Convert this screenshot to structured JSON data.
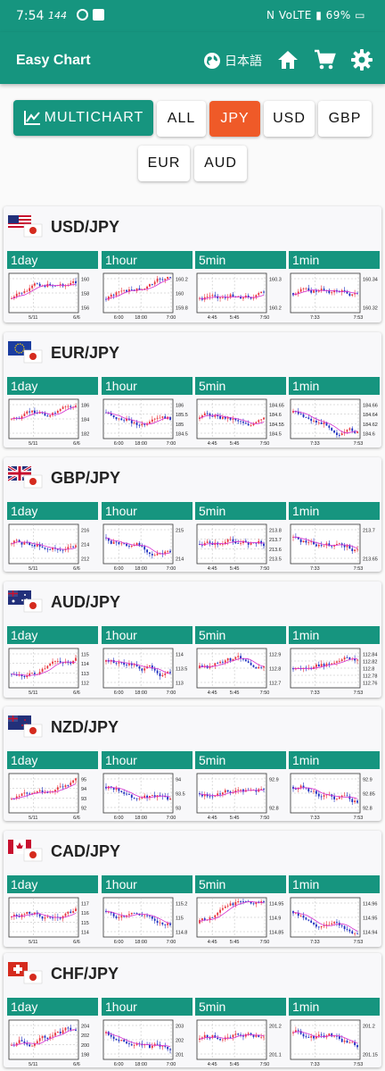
{
  "status_bar": {
    "time": "7:54",
    "net": "144",
    "network": "VoLTE",
    "battery": "69%"
  },
  "app_bar": {
    "title": "Easy Chart",
    "language": "日本語"
  },
  "filters": {
    "multichart": "MULTICHART",
    "buttons": [
      "ALL",
      "JPY",
      "USD",
      "GBP",
      "EUR",
      "AUD"
    ],
    "active": "JPY"
  },
  "timeframes": [
    "1day",
    "1hour",
    "5min",
    "1min"
  ],
  "colors": {
    "accent": "#16957f",
    "active": "#ef5a28",
    "bull": "#e8343c",
    "bear": "#1d2fc0",
    "ma": "#d52fd0"
  },
  "pairs": [
    {
      "name": "USD/JPY",
      "charts": [
        {
          "prices": [
            "160",
            "158",
            "156"
          ],
          "times": [
            "5/11",
            "6/6"
          ],
          "trend": "up"
        },
        {
          "prices": [
            "160.2",
            "160",
            "159.8"
          ],
          "times": [
            "6:00",
            "18:00",
            "7:00"
          ],
          "trend": "up"
        },
        {
          "prices": [
            "160.3",
            "160.2"
          ],
          "times": [
            "4:45",
            "5:45",
            "7:50"
          ],
          "trend": "up"
        },
        {
          "prices": [
            "160.34",
            "160.32"
          ],
          "times": [
            "7:33",
            "7:53"
          ],
          "trend": "flat"
        }
      ]
    },
    {
      "name": "EUR/JPY",
      "charts": [
        {
          "prices": [
            "186",
            "184",
            "182"
          ],
          "times": [
            "5/11",
            "6/6"
          ],
          "trend": "flat"
        },
        {
          "prices": [
            "186",
            "185.5",
            "185",
            "184.5"
          ],
          "times": [
            "6:00",
            "18:00",
            "7:00"
          ],
          "trend": "down"
        },
        {
          "prices": [
            "184.65",
            "184.6",
            "184.55",
            "184.5"
          ],
          "times": [
            "4:45",
            "5:45",
            "7:50"
          ],
          "trend": "flat"
        },
        {
          "prices": [
            "184.66",
            "184.64",
            "184.62",
            "184.6"
          ],
          "times": [
            "7:33",
            "7:53"
          ],
          "trend": "down"
        }
      ]
    },
    {
      "name": "GBP/JPY",
      "charts": [
        {
          "prices": [
            "216",
            "214",
            "212"
          ],
          "times": [
            "5/11",
            "6/6"
          ],
          "trend": "flat"
        },
        {
          "prices": [
            "215",
            "214"
          ],
          "times": [
            "6:00",
            "18:00",
            "7:00"
          ],
          "trend": "down"
        },
        {
          "prices": [
            "213.8",
            "213.7",
            "213.6",
            "213.5"
          ],
          "times": [
            "4:45",
            "5:45",
            "7:50"
          ],
          "trend": "flat"
        },
        {
          "prices": [
            "213.7",
            "213.65"
          ],
          "times": [
            "7:33",
            "7:53"
          ],
          "trend": "down"
        }
      ]
    },
    {
      "name": "AUD/JPY",
      "charts": [
        {
          "prices": [
            "115",
            "114",
            "113",
            "112"
          ],
          "times": [
            "5/11",
            "6/6"
          ],
          "trend": "up"
        },
        {
          "prices": [
            "114",
            "113.5",
            "113"
          ],
          "times": [
            "6:00",
            "18:00",
            "7:00"
          ],
          "trend": "down"
        },
        {
          "prices": [
            "112.9",
            "112.8",
            "112.7"
          ],
          "times": [
            "4:45",
            "5:45",
            "7:50"
          ],
          "trend": "flat"
        },
        {
          "prices": [
            "112.84",
            "112.82",
            "112.8",
            "112.78",
            "112.76"
          ],
          "times": [
            "7:33",
            "7:53"
          ],
          "trend": "flat"
        }
      ]
    },
    {
      "name": "NZD/JPY",
      "charts": [
        {
          "prices": [
            "95",
            "94",
            "93",
            "92"
          ],
          "times": [
            "5/11",
            "6/6"
          ],
          "trend": "up"
        },
        {
          "prices": [
            "94",
            "93.5",
            "93"
          ],
          "times": [
            "6:00",
            "18:00",
            "7:00"
          ],
          "trend": "down"
        },
        {
          "prices": [
            "92.9",
            "92.8"
          ],
          "times": [
            "4:45",
            "5:45",
            "7:50"
          ],
          "trend": "flat"
        },
        {
          "prices": [
            "92.9",
            "92.85",
            "92.8"
          ],
          "times": [
            "7:33",
            "7:53"
          ],
          "trend": "down"
        }
      ]
    },
    {
      "name": "CAD/JPY",
      "charts": [
        {
          "prices": [
            "117",
            "116",
            "115",
            "114"
          ],
          "times": [
            "5/11",
            "6/6"
          ],
          "trend": "flat"
        },
        {
          "prices": [
            "115.2",
            "115",
            "114.8"
          ],
          "times": [
            "6:00",
            "18:00",
            "7:00"
          ],
          "trend": "down"
        },
        {
          "prices": [
            "114.95",
            "114.9",
            "114.85"
          ],
          "times": [
            "4:45",
            "5:45",
            "7:50"
          ],
          "trend": "up"
        },
        {
          "prices": [
            "114.96",
            "114.95",
            "114.94"
          ],
          "times": [
            "7:33",
            "7:53"
          ],
          "trend": "down"
        }
      ]
    },
    {
      "name": "CHF/JPY",
      "charts": [
        {
          "prices": [
            "204",
            "202",
            "200",
            "198"
          ],
          "times": [
            "5/11",
            "6/6"
          ],
          "trend": "up"
        },
        {
          "prices": [
            "203",
            "202",
            "201"
          ],
          "times": [
            "6:00",
            "18:00",
            "7:00"
          ],
          "trend": "down"
        },
        {
          "prices": [
            "201.2",
            "201.1"
          ],
          "times": [
            "4:45",
            "5:45",
            "7:50"
          ],
          "trend": "flat"
        },
        {
          "prices": [
            "201.2",
            "201.15"
          ],
          "times": [
            "7:33",
            "7:53"
          ],
          "trend": "down"
        }
      ]
    }
  ]
}
